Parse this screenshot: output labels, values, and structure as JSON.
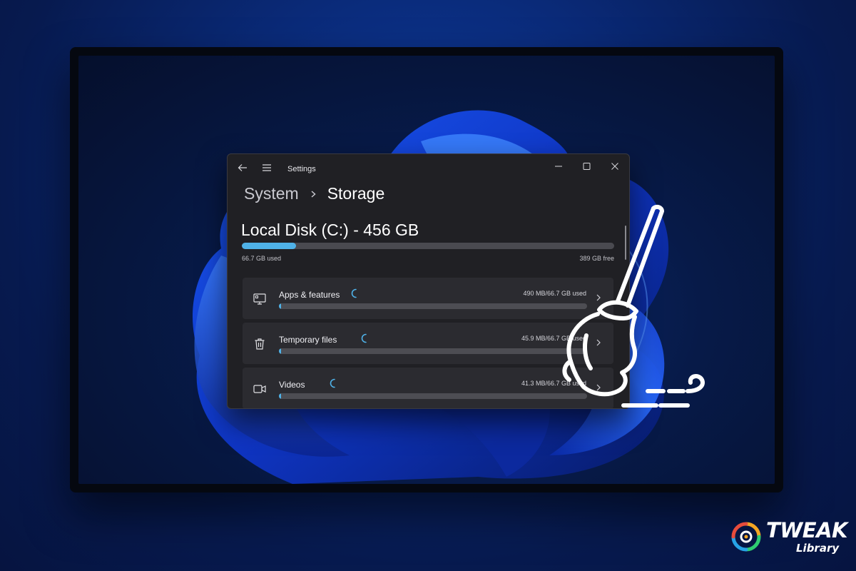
{
  "window": {
    "title": "Settings",
    "breadcrumb": {
      "parent": "System",
      "current": "Storage"
    }
  },
  "disk": {
    "title": "Local Disk (C:) - 456 GB",
    "used_label": "66.7 GB used",
    "free_label": "389 GB free",
    "used_fraction": 0.146
  },
  "categories": [
    {
      "icon": "monitor-apps-icon",
      "label": "Apps & features",
      "size": "490 MB/66.7 GB used",
      "fraction": 0.007
    },
    {
      "icon": "trash-icon",
      "label": "Temporary files",
      "size": "45.9 MB/66.7 GB used",
      "fraction": 0.001
    },
    {
      "icon": "video-camera-icon",
      "label": "Videos",
      "size": "41.3 MB/66.7 GB used",
      "fraction": 0.001
    }
  ],
  "brand": {
    "name": "TWEAK",
    "sub": "Library"
  },
  "colors": {
    "accent": "#4fb2e8",
    "window_bg": "#202024",
    "row_bg": "#2b2b30"
  }
}
